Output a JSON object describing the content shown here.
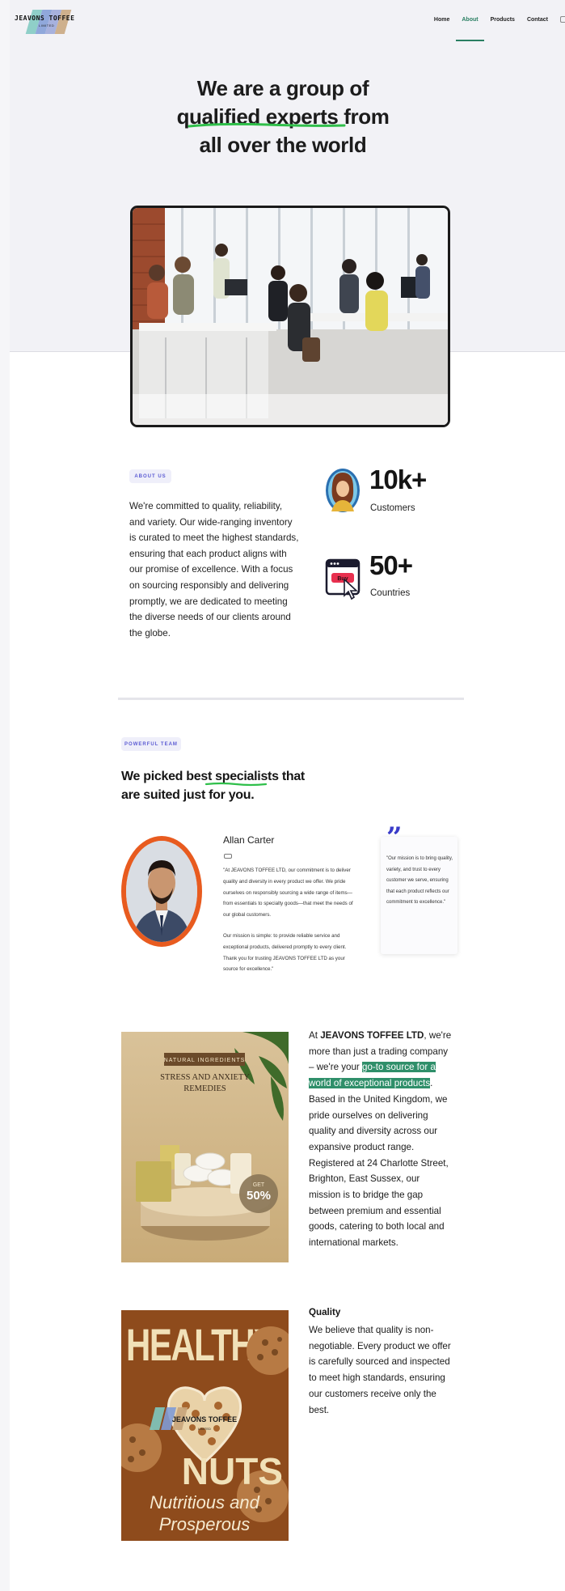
{
  "brand": {
    "logo_text": "JEAVONS TOFFEE",
    "logo_sub": "LIMITED",
    "colors": {
      "accent": "#2a7f62",
      "stripe_blue": "#7f9bd6",
      "stripe_teal": "#7ec9c0",
      "stripe_tan": "#c8a47a"
    }
  },
  "nav": {
    "items": [
      {
        "label": "Home",
        "active": false
      },
      {
        "label": "About",
        "active": true
      },
      {
        "label": "Products",
        "active": false
      },
      {
        "label": "Contact",
        "active": false
      }
    ]
  },
  "hero": {
    "line1": "We are a group of",
    "highlight": "qualified experts",
    "line2_rest": " from",
    "line3": "all over the world",
    "image_icon": "office-team-photo"
  },
  "about": {
    "pill": "ABOUT US",
    "paragraph": "We're committed to quality, reliability, and variety. Our wide-ranging inventory is curated to meet the highest standards, ensuring that each product aligns with our promise of excellence. With a focus on sourcing responsibly and delivering promptly, we are dedicated to meeting the diverse needs of our clients around the globe.",
    "stats": [
      {
        "value": "10k+",
        "label": "Customers",
        "icon": "customer-avatar-icon"
      },
      {
        "value": "50+",
        "label": "Countries",
        "icon": "browser-click-icon",
        "icon_text": "Buy"
      }
    ]
  },
  "team": {
    "pill": "POWERFUL TEAM",
    "title_start": "We picked best ",
    "title_highlight": "specialists",
    "title_end": " that are suited just for you.",
    "member": {
      "name": "Allan Carter",
      "para1": "\"At JEAVONS TOFFEE LTD, our commitment is to deliver quality and diversity in every product we offer. We pride ourselves on responsibly sourcing a wide range of items—from essentials to specialty goods—that meet the needs of our global customers.",
      "para2": "Our mission is simple: to provide reliable service and exceptional products, delivered promptly to every client. Thank you for trusting JEAVONS TOFFEE LTD as your source for excellence.\""
    },
    "quote": {
      "mark": "”",
      "text": "\"Our mission is to bring quality, variety, and trust to every customer we serve, ensuring that each product reflects our commitment to excellence.\""
    }
  },
  "product": {
    "badge": "NATURAL INGREDIENTS",
    "heading": "STRESS AND ANXIETY REMEDIES",
    "discount_label": "GET",
    "discount": "50%",
    "text_start": "At ",
    "company": "JEAVONS TOFFEE LTD",
    "text_mid": ", we're more than just a trading company – we're your ",
    "highlight": "go-to source for a world of exceptional products",
    "text_end": ". Based in the United Kingdom, we pride ourselves on delivering quality and diversity across our expansive product range. Registered at 24 Charlotte Street, Brighton, East Sussex, our mission is to bridge the gap between premium and essential goods, catering to both local and international markets."
  },
  "quality": {
    "heading": "Quality",
    "text": "We believe that quality is non-negotiable. Every product we offer is carefully sourced and inspected to meet high standards, ensuring our customers receive only the best.",
    "poster_word1": "HEALTHY",
    "poster_word2": "NUTS",
    "poster_script1": "Nutritious and",
    "poster_script2": "Prosperous",
    "poster_logo": "JEAVONS TOFFEE",
    "poster_logo_sub": "LIMITED"
  }
}
